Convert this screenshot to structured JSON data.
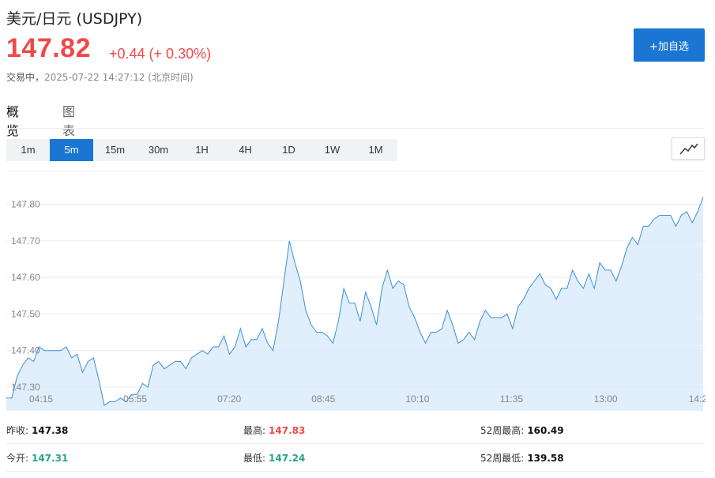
{
  "header": {
    "title": "美元/日元  (USDJPY)",
    "price": "147.82",
    "change": "+0.44 (+ 0.30%)",
    "status_label": "交易中，",
    "timestamp": "2025-07-22 14:27:12 (北京时间)",
    "add_watchlist_label": "+加自选"
  },
  "tabs": [
    {
      "label": "概览",
      "active": true
    },
    {
      "label": "图表",
      "active": false
    }
  ],
  "periods": [
    {
      "label": "1m",
      "active": false
    },
    {
      "label": "5m",
      "active": true
    },
    {
      "label": "15m",
      "active": false
    },
    {
      "label": "30m",
      "active": false
    },
    {
      "label": "1H",
      "active": false
    },
    {
      "label": "4H",
      "active": false
    },
    {
      "label": "1D",
      "active": false
    },
    {
      "label": "1W",
      "active": false
    },
    {
      "label": "1M",
      "active": false
    }
  ],
  "chart_type_icon": "line-chart-icon",
  "colors": {
    "up": "#f04848",
    "down": "#27a38b",
    "accent": "#1a76d2",
    "line": "#3a8fd8",
    "fill": "#dcebfb"
  },
  "chart_data": {
    "type": "area",
    "yticks": [
      "147.30",
      "147.40",
      "147.50",
      "147.60",
      "147.70",
      "147.80"
    ],
    "xticks": [
      "04:15",
      "05:55",
      "07:20",
      "08:45",
      "10:10",
      "11:35",
      "13:00",
      "14:2"
    ],
    "ylim": [
      147.235,
      147.89
    ],
    "grid": true,
    "values": [
      147.27,
      147.27,
      147.33,
      147.36,
      147.38,
      147.37,
      147.41,
      147.4,
      147.4,
      147.4,
      147.4,
      147.41,
      147.38,
      147.39,
      147.34,
      147.37,
      147.38,
      147.32,
      147.25,
      147.26,
      147.26,
      147.27,
      147.26,
      147.28,
      147.28,
      147.31,
      147.3,
      147.36,
      147.37,
      147.35,
      147.36,
      147.37,
      147.37,
      147.35,
      147.38,
      147.39,
      147.4,
      147.39,
      147.41,
      147.41,
      147.44,
      147.39,
      147.41,
      147.46,
      147.41,
      147.43,
      147.43,
      147.46,
      147.42,
      147.4,
      147.48,
      147.59,
      147.7,
      147.64,
      147.59,
      147.51,
      147.47,
      147.45,
      147.45,
      147.44,
      147.42,
      147.48,
      147.57,
      147.53,
      147.53,
      147.48,
      147.56,
      147.52,
      147.47,
      147.57,
      147.62,
      147.57,
      147.59,
      147.58,
      147.52,
      147.49,
      147.45,
      147.42,
      147.45,
      147.45,
      147.46,
      147.51,
      147.47,
      147.42,
      147.43,
      147.45,
      147.43,
      147.48,
      147.51,
      147.49,
      147.49,
      147.49,
      147.5,
      147.46,
      147.52,
      147.54,
      147.57,
      147.59,
      147.61,
      147.58,
      147.57,
      147.54,
      147.57,
      147.57,
      147.62,
      147.59,
      147.57,
      147.61,
      147.57,
      147.64,
      147.62,
      147.62,
      147.59,
      147.63,
      147.68,
      147.71,
      147.69,
      147.74,
      147.74,
      147.76,
      147.77,
      147.77,
      147.77,
      147.74,
      147.77,
      147.78,
      147.75,
      147.78,
      147.82
    ]
  },
  "stats": {
    "prev_close_label": "昨收:",
    "prev_close": "147.38",
    "high_label": "最高:",
    "high": "147.83",
    "week52_high_label": "52周最高:",
    "week52_high": "160.49",
    "open_label": "今开:",
    "open": "147.31",
    "low_label": "最低:",
    "low": "147.24",
    "week52_low_label": "52周最低:",
    "week52_low": "139.58"
  }
}
